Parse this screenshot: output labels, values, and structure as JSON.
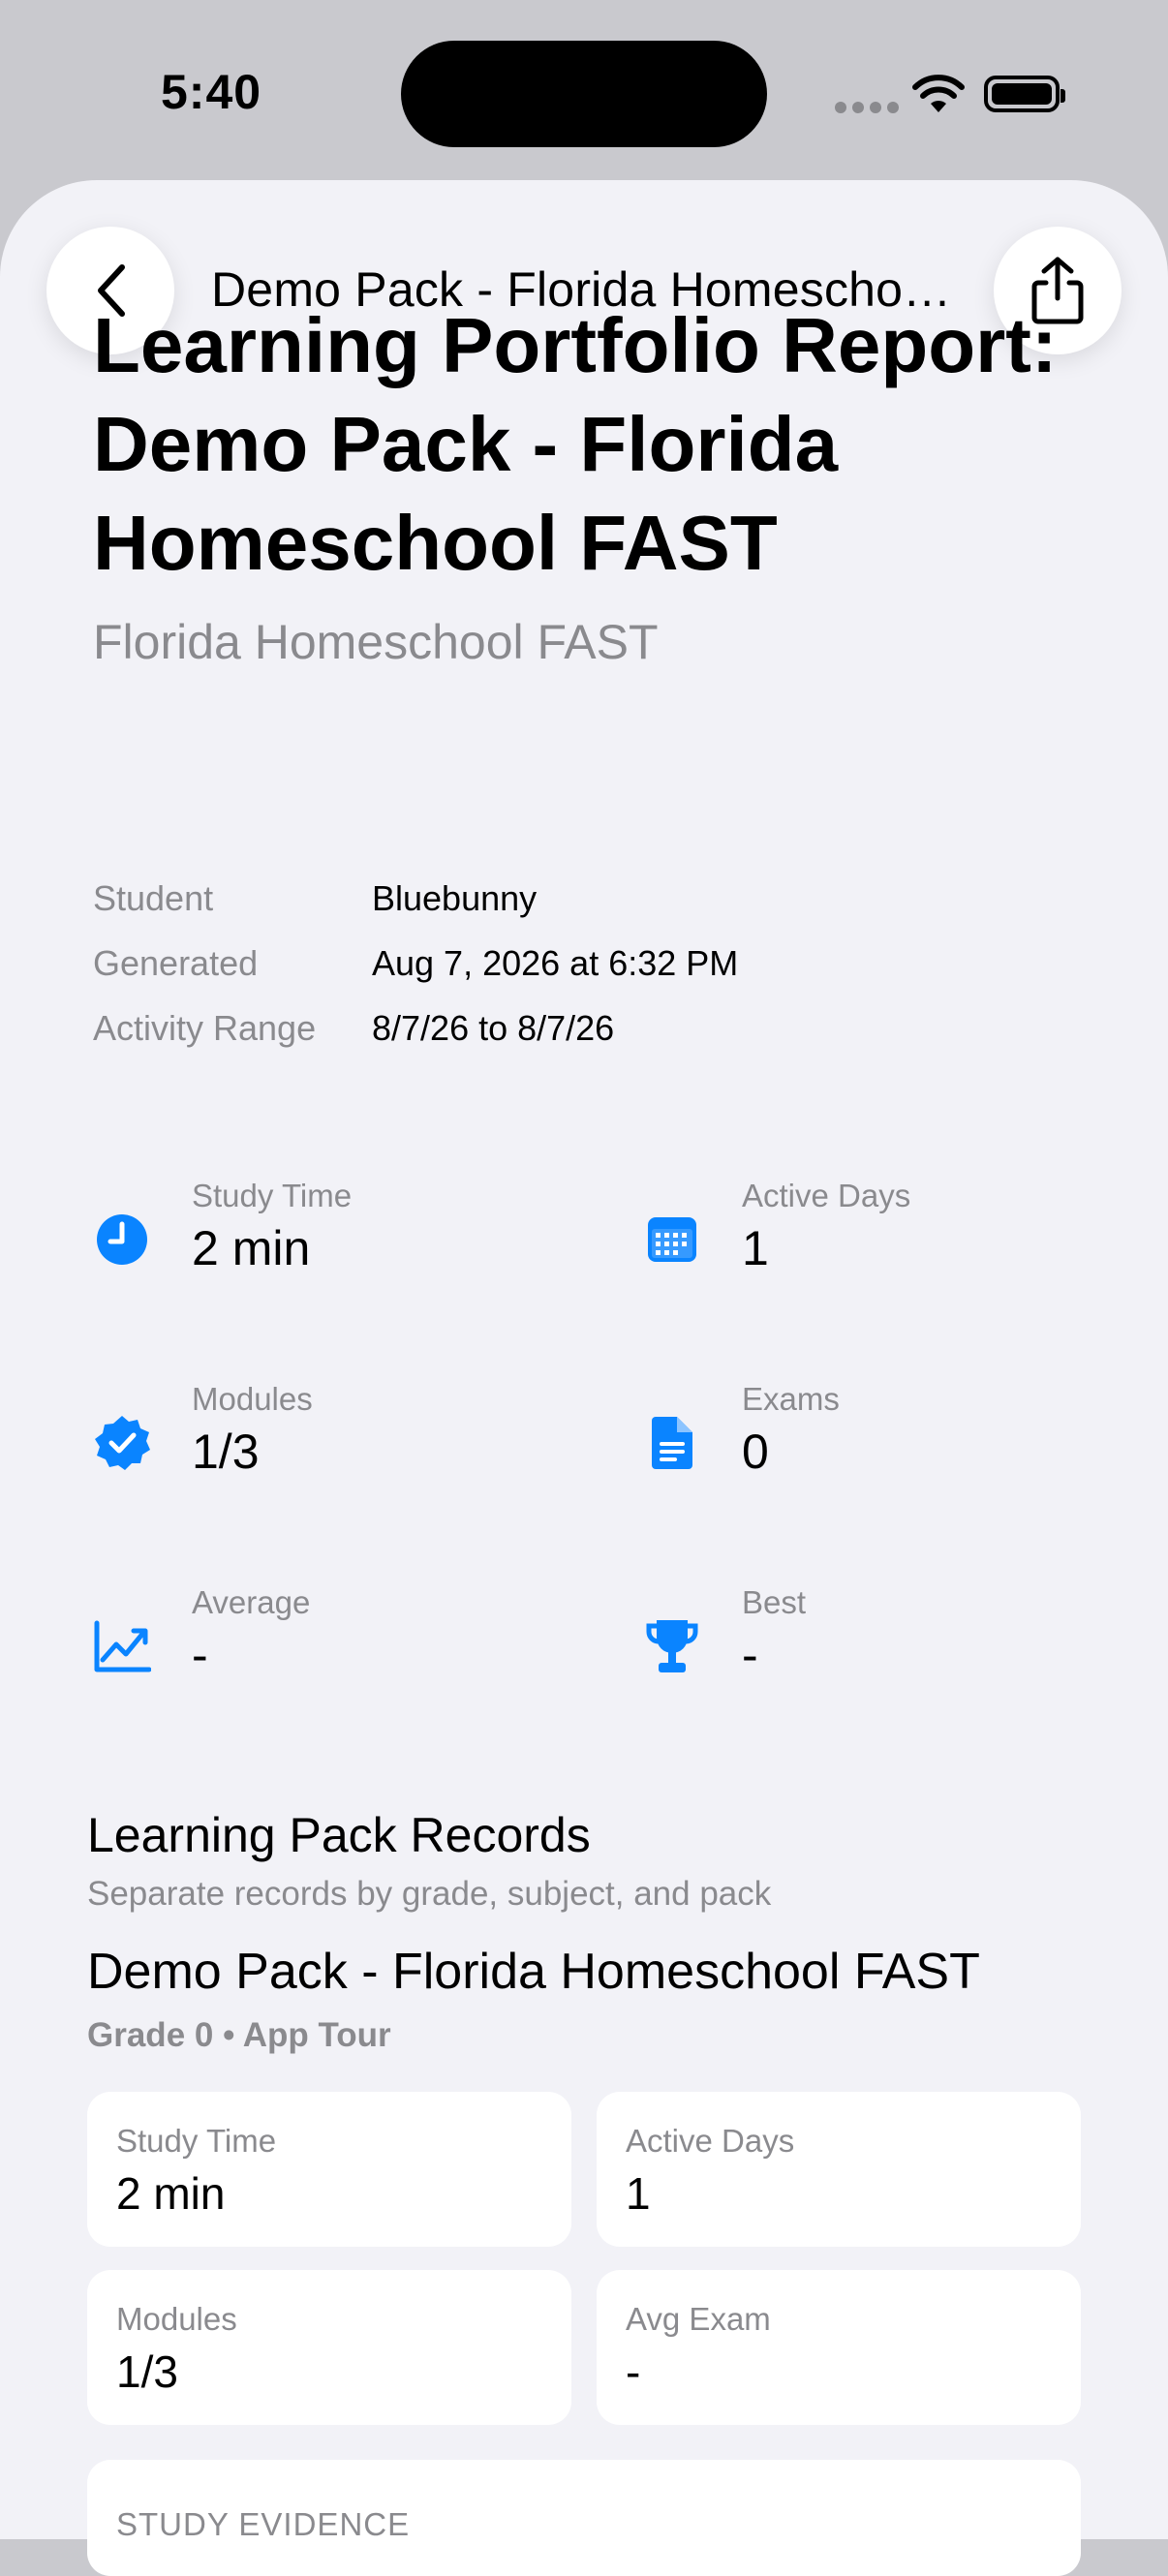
{
  "status_bar": {
    "time": "5:40"
  },
  "nav": {
    "title": "Demo Pack - Florida Homeschool FAST"
  },
  "report": {
    "title": "Learning Portfolio Report: Demo Pack - Florida Homeschool FAST",
    "subtitle": "Florida Homeschool FAST",
    "meta": [
      {
        "label": "Student",
        "value": "Bluebunny"
      },
      {
        "label": "Generated",
        "value": "Aug 7, 2026 at 6:32 PM"
      },
      {
        "label": "Activity Range",
        "value": "8/7/26 to 8/7/26"
      }
    ]
  },
  "stats": [
    {
      "label": "Study Time",
      "value": "2 min",
      "icon": "clock-icon"
    },
    {
      "label": "Active Days",
      "value": "1",
      "icon": "calendar-icon"
    },
    {
      "label": "Modules",
      "value": "1/3",
      "icon": "checkmark-seal-icon"
    },
    {
      "label": "Exams",
      "value": "0",
      "icon": "document-icon"
    },
    {
      "label": "Average",
      "value": "-",
      "icon": "chart-line-icon"
    },
    {
      "label": "Best",
      "value": "-",
      "icon": "trophy-icon"
    }
  ],
  "records": {
    "title": "Learning Pack Records",
    "subtitle": "Separate records by grade, subject, and pack",
    "pack_title": "Demo Pack - Florida Homeschool FAST",
    "pack_meta": "Grade 0 • App Tour",
    "cards": [
      {
        "label": "Study Time",
        "value": "2 min"
      },
      {
        "label": "Active Days",
        "value": "1"
      },
      {
        "label": "Modules",
        "value": "1/3"
      },
      {
        "label": "Avg Exam",
        "value": "-"
      }
    ],
    "evidence_title": "STUDY EVIDENCE"
  },
  "colors": {
    "accent": "#0a84ff",
    "background": "#f2f2f7",
    "secondary_text": "#8a8a8e"
  }
}
